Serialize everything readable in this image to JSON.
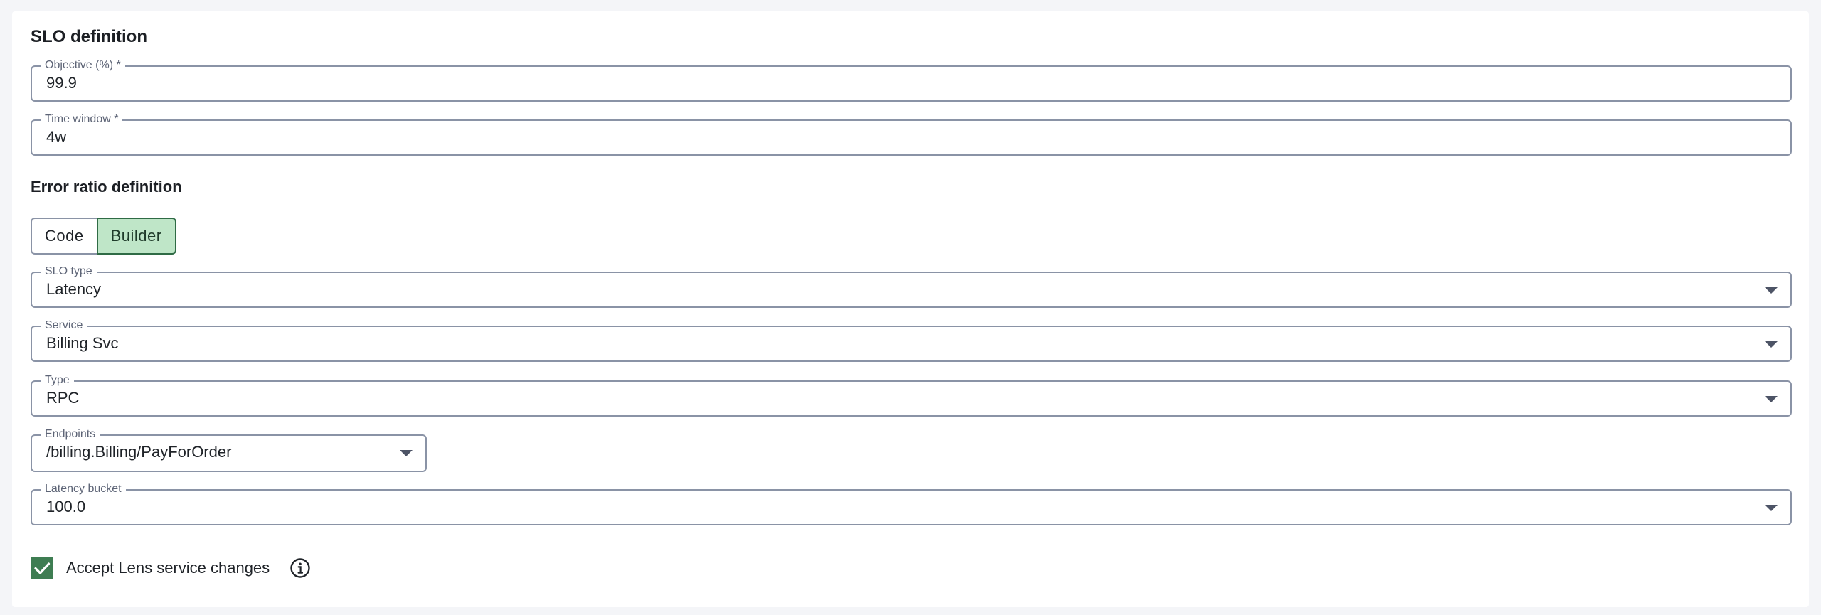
{
  "slo_definition": {
    "title": "SLO definition",
    "objective": {
      "label": "Objective (%) *",
      "value": "99.9"
    },
    "time_window": {
      "label": "Time window *",
      "value": "4w"
    }
  },
  "error_ratio": {
    "title": "Error ratio definition",
    "modes": {
      "code": "Code",
      "builder": "Builder",
      "selected": "Builder"
    },
    "slo_type": {
      "label": "SLO type",
      "value": "Latency"
    },
    "service": {
      "label": "Service",
      "value": "Billing Svc"
    },
    "type": {
      "label": "Type",
      "value": "RPC"
    },
    "endpoints": {
      "label": "Endpoints",
      "value": "/billing.Billing/PayForOrder"
    },
    "latency_bucket": {
      "label": "Latency bucket",
      "value": "100.0"
    }
  },
  "accept_changes": {
    "label": "Accept Lens service changes",
    "checked": true
  },
  "icons": {
    "dropdown": "chevron-down-icon",
    "check": "checkmark-icon",
    "info": "info-icon"
  },
  "colors": {
    "builder_active_bg": "#bfe6c8",
    "checkbox": "#3e7d52"
  }
}
